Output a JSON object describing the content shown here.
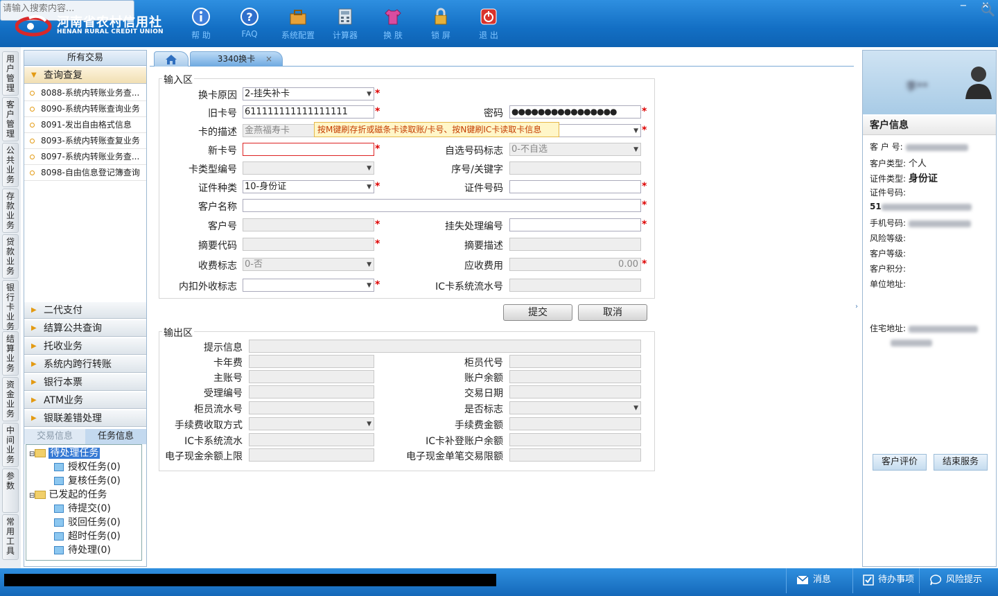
{
  "header": {
    "logo_cn": "河南省农村信用社",
    "logo_en": "HENAN RURAL CREDIT UNION",
    "toolbar": [
      {
        "label": "帮 助",
        "icon": "info-icon"
      },
      {
        "label": "FAQ",
        "icon": "question-icon"
      },
      {
        "label": "系统配置",
        "icon": "toolbox-icon"
      },
      {
        "label": "计算器",
        "icon": "calculator-icon"
      },
      {
        "label": "换 肤",
        "icon": "shirt-icon"
      },
      {
        "label": "锁 屏",
        "icon": "lock-icon"
      },
      {
        "label": "退 出",
        "icon": "power-icon"
      }
    ],
    "window_controls": {
      "minimize": "−",
      "close": "✕"
    },
    "search_placeholder": "请输入搜索内容..."
  },
  "vertical_tabs": [
    "用户管理",
    "客户管理",
    "公共业务",
    "存款业务",
    "贷款业务",
    "银行卡业务",
    "结算业务",
    "资金业务",
    "中间业务",
    "参数",
    "常用工具"
  ],
  "left_panel": {
    "title": "所有交易",
    "open_group": "查询查复",
    "items": [
      "8088-系统内转账业务查...",
      "8090-系统内转账查询业务",
      "8091-发出自由格式信息",
      "8093-系统内转账查复业务",
      "8097-系统内转账业务查...",
      "8098-自由信息登记簿查询"
    ],
    "groups": [
      "二代支付",
      "结算公共查询",
      "托收业务",
      "系统内跨行转账",
      "银行本票",
      "ATM业务",
      "银联差错处理"
    ],
    "tabs": {
      "trade_info": "交易信息",
      "task_info": "任务信息"
    },
    "tree": {
      "pending": "待处理任务",
      "pending_children": [
        "授权任务(0)",
        "复核任务(0)"
      ],
      "initiated": "已发起的任务",
      "initiated_children": [
        "待提交(0)",
        "驳回任务(0)",
        "超时任务(0)",
        "待处理(0)"
      ]
    }
  },
  "tabs": {
    "home_icon": "home-icon",
    "active_tab": "3340换卡",
    "close": "×"
  },
  "input_area": {
    "title": "输入区",
    "fields": {
      "reason": {
        "label": "换卡原因",
        "value": "2-挂失补卡"
      },
      "old_card": {
        "label": "旧卡号",
        "value": "611111111111111111"
      },
      "password": {
        "label": "密码",
        "value": "●●●●●●●●●●●●●●●●"
      },
      "card_desc": {
        "label": "卡的描述",
        "value": "金燕福寿卡"
      },
      "new_card": {
        "label": "新卡号",
        "value": ""
      },
      "self_select": {
        "label": "自选号码标志",
        "value": "0-不自选"
      },
      "card_type": {
        "label": "卡类型编号",
        "value": ""
      },
      "seq_key": {
        "label": "序号/关键字",
        "value": ""
      },
      "id_type": {
        "label": "证件种类",
        "value": "10-身份证"
      },
      "id_no": {
        "label": "证件号码",
        "value": ""
      },
      "cust_name": {
        "label": "客户名称",
        "value": ""
      },
      "cust_no": {
        "label": "客户号",
        "value": ""
      },
      "loss_no": {
        "label": "挂失处理编号",
        "value": ""
      },
      "summary_code": {
        "label": "摘要代码",
        "value": ""
      },
      "summary_desc": {
        "label": "摘要描述",
        "value": ""
      },
      "fee_flag": {
        "label": "收费标志",
        "value": "0-否"
      },
      "fee_amount": {
        "label": "应收费用",
        "value": "0.00"
      },
      "inout_flag": {
        "label": "内扣外收标志",
        "value": ""
      },
      "ic_serial": {
        "label": "IC卡系统流水号",
        "value": ""
      }
    },
    "tooltip": "按M键刷存折或磁条卡读取账/卡号、按N键刷IC卡读取卡信息",
    "submit": "提交",
    "cancel": "取消"
  },
  "output_area": {
    "title": "输出区",
    "labels": {
      "hint": "提示信息",
      "card_fee": "卡年费",
      "teller_code": "柜员代号",
      "main_account": "主账号",
      "balance": "账户余额",
      "accept_no": "受理编号",
      "trade_date": "交易日期",
      "teller_serial": "柜员流水号",
      "yes_no": "是否标志",
      "fee_method": "手续费收取方式",
      "fee_amount": "手续费金额",
      "ic_serial": "IC卡系统流水",
      "ic_balance": "IC卡补登账户余额",
      "ecash_limit": "电子现金余额上限",
      "ecash_single": "电子现金单笔交易限额"
    }
  },
  "customer": {
    "title": "客户信息",
    "name_blurred": "李**",
    "cust_no_label": "客 户 号:",
    "cust_type_label": "客户类型:",
    "cust_type": "个人",
    "id_type_label": "证件类型:",
    "id_type": "身份证",
    "id_no_label": "证件号码:",
    "id_no_prefix": "51",
    "phone_label": "手机号码:",
    "risk_label": "风险等级:",
    "level_label": "客户等级:",
    "points_label": "客户积分:",
    "unit_label": "单位地址:",
    "home_label": "住宅地址:",
    "eval_button": "客户评价",
    "end_button": "结束服务"
  },
  "status_bar": {
    "message": "消息",
    "todo": "待办事项",
    "risk": "风险提示"
  }
}
